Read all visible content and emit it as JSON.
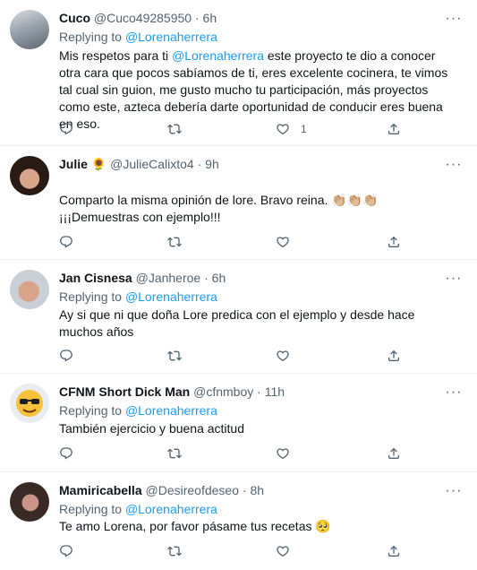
{
  "tweets": [
    {
      "name": "Cuco",
      "handle": "@Cuco49285950",
      "time": "6h",
      "replying_label": "Replying to",
      "replying_to": "@Lorenaherrera",
      "text_before": "Mis respetos para ti ",
      "text_mention": "@Lorenaherrera",
      "text_after": " este proyecto te dio a conocer otra cara que pocos sabíamos de ti, eres excelente cocinera, te vimos tal cual sin guion, me gusto mucho tu participación, más proyectos como este, azteca debería darte oportunidad de conducir eres buena en eso.",
      "like_count": "1"
    },
    {
      "name": "Julie",
      "name_emoji": "🌻",
      "handle": "@JulieCalixto4",
      "time": "9h",
      "text": "Comparto la misma opinión de lore. Bravo reina. 👏🏼👏🏼👏🏼 ¡¡¡Demuestras con ejemplo!!!"
    },
    {
      "name": "Jan Cisnesa",
      "handle": "@Janheroe",
      "time": "6h",
      "replying_label": "Replying to",
      "replying_to": "@Lorenaherrera",
      "text": "Ay si que ni que doña Lore predica con el ejemplo y desde hace muchos años"
    },
    {
      "name": "CFNM Short Dick Man",
      "handle": "@cfnmboy",
      "time": "11h",
      "replying_label": "Replying to",
      "replying_to": "@Lorenaherrera",
      "text": "También ejercicio y buena actitud"
    },
    {
      "name": "Mamiricabella",
      "handle": "@Desireofdeseo",
      "time": "8h",
      "replying_label": "Replying to",
      "replying_to": "@Lorenaherrera",
      "text": "Te amo Lorena, por favor pásame tus recetas 🥺"
    }
  ],
  "separator": "·",
  "more_glyph": "···"
}
